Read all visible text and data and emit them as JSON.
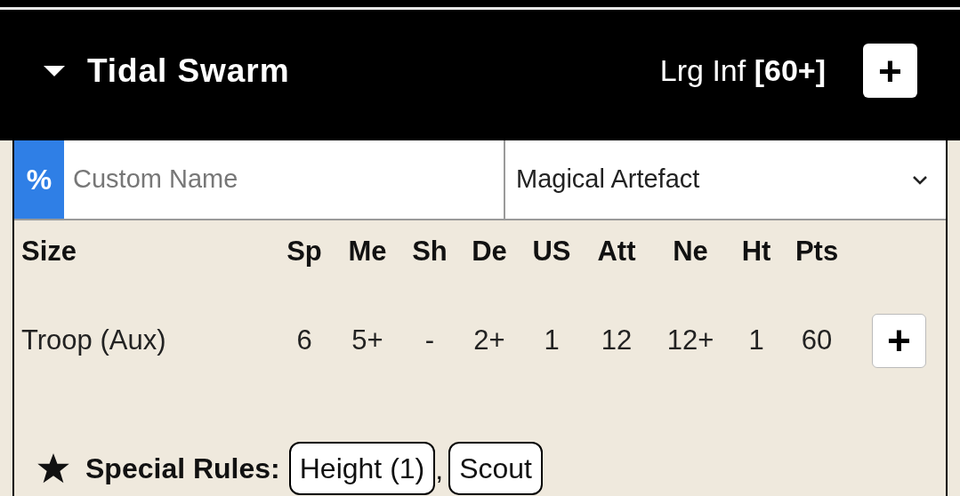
{
  "header": {
    "expanded": true,
    "title": "Tidal Swarm",
    "unit_type": "Lrg Inf **[60+]**",
    "add_button": "+"
  },
  "name_row": {
    "percent_label": "%",
    "custom_name": {
      "placeholder": "Custom Name"
    },
    "artefact_select": {
      "value": "Magical Artefact"
    }
  },
  "stats": {
    "columns": [
      "Size",
      "Sp",
      "Me",
      "Sh",
      "De",
      "US",
      "Att",
      "Ne",
      "Ht",
      "Pts"
    ],
    "rows": [
      {
        "cells": [
          "Troop (Aux)",
          "6",
          "5+",
          "-",
          "2+",
          "1",
          "12",
          "12+",
          "1",
          "60"
        ],
        "add_button": "+"
      }
    ]
  },
  "special_rules": {
    "label": "Special Rules:",
    "rules": [
      {
        "text": "Height (1)",
        "separator": ","
      },
      {
        "text": "Scout"
      }
    ]
  }
}
